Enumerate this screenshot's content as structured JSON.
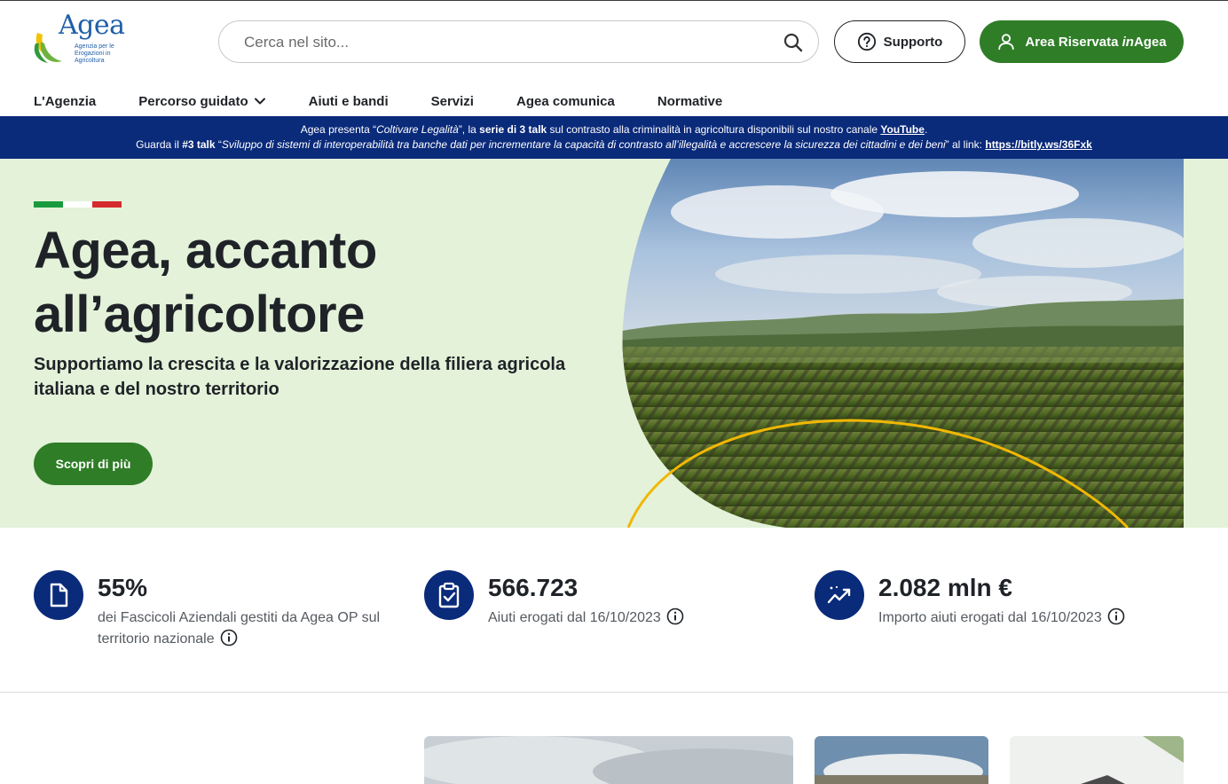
{
  "logo": {
    "word": "Agea",
    "subtitle": "Agenzia per le Erogazioni in Agricoltura"
  },
  "search": {
    "placeholder": "Cerca nel sito..."
  },
  "header": {
    "support_label": "Supporto",
    "area_label_prefix": "Area Riservata ",
    "area_label_italic": "in",
    "area_label_suffix": "Agea"
  },
  "nav": {
    "items": [
      {
        "label": "L'Agenzia"
      },
      {
        "label": "Percorso guidato"
      },
      {
        "label": "Aiuti e bandi"
      },
      {
        "label": "Servizi"
      },
      {
        "label": "Agea comunica"
      },
      {
        "label": "Normative"
      }
    ]
  },
  "banner": {
    "l1_a": "Agea presenta “",
    "l1_b": "Coltivare Legalità",
    "l1_c": "”, la ",
    "l1_d": "serie di 3 talk",
    "l1_e": " sul contrasto alla criminalità in agricoltura disponibili sul nostro canale ",
    "l1_link": "YouTube",
    "l1_f": ".",
    "l2_a": "Guarda il ",
    "l2_b": "#3 talk",
    "l2_c": " “",
    "l2_d": "Sviluppo di sistemi di interoperabilità tra banche dati per incrementare la capacità di contrasto all’illegalità e accrescere la sicurezza dei cittadini e dei beni",
    "l2_e": "” al link: ",
    "l2_link": "https://bitly.ws/36Fxk"
  },
  "hero": {
    "title_line1": "Agea, accanto",
    "title_line2": "all’agricoltore",
    "subtitle": "Supportiamo la crescita e la valorizzazione della filiera agricola italiana e del nostro territorio",
    "cta": "Scopri di più"
  },
  "stats": [
    {
      "value": "55%",
      "label": "dei Fascicoli Aziendali gestiti da Agea OP sul territorio nazionale",
      "icon": "document-icon"
    },
    {
      "value": "566.723",
      "label": "Aiuti erogati dal 16/10/2023",
      "icon": "clipboard-check-icon"
    },
    {
      "value": "2.082 mln €",
      "label": "Importo aiuti erogati dal 16/10/2023",
      "icon": "trend-chart-icon"
    }
  ],
  "colors": {
    "brand_green": "#2f7d27",
    "brand_blue": "#0a2a7a",
    "hero_bg": "#e3f2d9",
    "flag_green": "#1a9a3e",
    "flag_white": "#ffffff",
    "flag_red": "#d52b2e"
  }
}
